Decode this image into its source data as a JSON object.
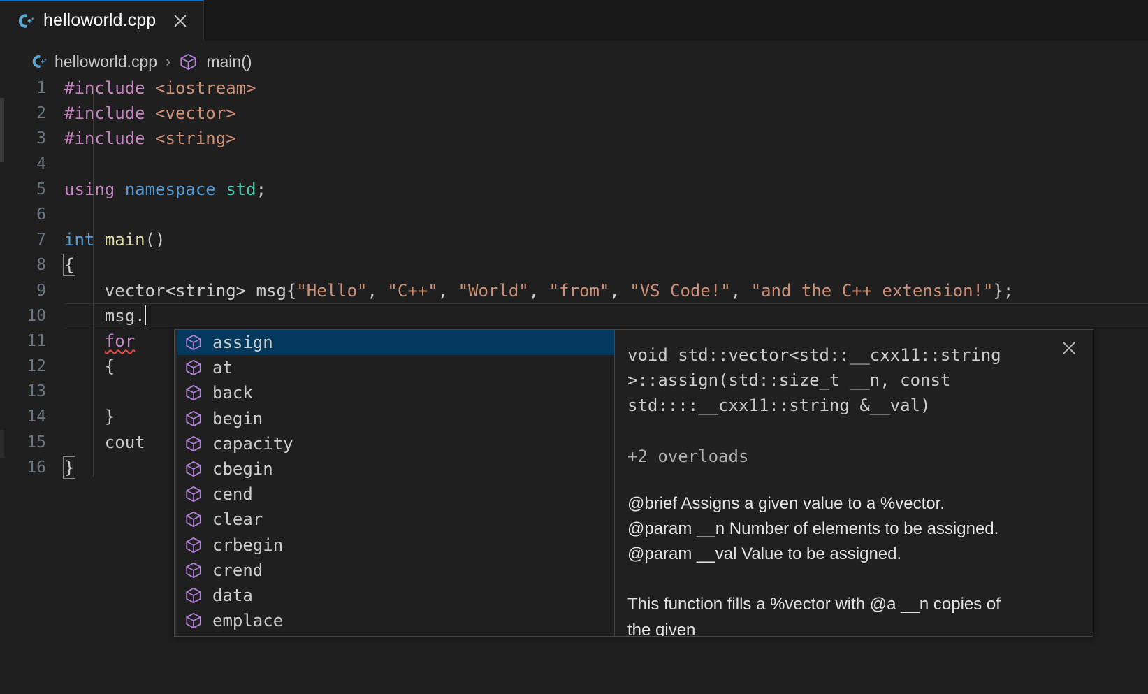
{
  "window": {
    "background": "#1f1f1f",
    "accent": "#0078d4",
    "selection": "#04395e"
  },
  "tab": {
    "label": "helloworld.cpp",
    "icon": "cpp-file-icon",
    "close": "close-icon"
  },
  "breadcrumb": {
    "file": "helloworld.cpp",
    "separator": "›",
    "symbol": "main()",
    "file_icon": "cpp-file-icon",
    "symbol_icon": "cube-symbol-icon"
  },
  "editor": {
    "lines": [
      {
        "number": "1",
        "tokens": [
          {
            "text": "#include",
            "cls": "t-pre"
          },
          {
            "text": " ",
            "cls": "t-plain"
          },
          {
            "text": "<iostream>",
            "cls": "t-inc"
          }
        ]
      },
      {
        "number": "2",
        "tokens": [
          {
            "text": "#include",
            "cls": "t-pre"
          },
          {
            "text": " ",
            "cls": "t-plain"
          },
          {
            "text": "<vector>",
            "cls": "t-inc"
          }
        ]
      },
      {
        "number": "3",
        "tokens": [
          {
            "text": "#include",
            "cls": "t-pre"
          },
          {
            "text": " ",
            "cls": "t-plain"
          },
          {
            "text": "<string>",
            "cls": "t-inc"
          }
        ]
      },
      {
        "number": "4",
        "tokens": []
      },
      {
        "number": "5",
        "tokens": [
          {
            "text": "using",
            "cls": "t-kw"
          },
          {
            "text": " ",
            "cls": "t-plain"
          },
          {
            "text": "namespace",
            "cls": "t-blue"
          },
          {
            "text": " ",
            "cls": "t-plain"
          },
          {
            "text": "std",
            "cls": "t-ns"
          },
          {
            "text": ";",
            "cls": "t-plain"
          }
        ]
      },
      {
        "number": "6",
        "tokens": []
      },
      {
        "number": "7",
        "tokens": [
          {
            "text": "int",
            "cls": "t-blue"
          },
          {
            "text": " ",
            "cls": "t-plain"
          },
          {
            "text": "main",
            "cls": "t-fn"
          },
          {
            "text": "()",
            "cls": "t-plain"
          }
        ]
      },
      {
        "number": "8",
        "tokens": [
          {
            "text": "{",
            "cls": "t-plain brk"
          }
        ]
      },
      {
        "number": "9",
        "tokens": [
          {
            "text": "    ",
            "cls": "t-plain"
          },
          {
            "text": "vector",
            "cls": "t-plain"
          },
          {
            "text": "<",
            "cls": "t-plain"
          },
          {
            "text": "string",
            "cls": "t-plain"
          },
          {
            "text": "> msg{",
            "cls": "t-plain"
          },
          {
            "text": "\"Hello\"",
            "cls": "t-str"
          },
          {
            "text": ", ",
            "cls": "t-plain"
          },
          {
            "text": "\"C++\"",
            "cls": "t-str"
          },
          {
            "text": ", ",
            "cls": "t-plain"
          },
          {
            "text": "\"World\"",
            "cls": "t-str"
          },
          {
            "text": ", ",
            "cls": "t-plain"
          },
          {
            "text": "\"from\"",
            "cls": "t-str"
          },
          {
            "text": ", ",
            "cls": "t-plain"
          },
          {
            "text": "\"VS Code!\"",
            "cls": "t-str"
          },
          {
            "text": ", ",
            "cls": "t-plain"
          },
          {
            "text": "\"and the C++ extension!\"",
            "cls": "t-str"
          },
          {
            "text": "};",
            "cls": "t-plain"
          }
        ]
      },
      {
        "number": "10",
        "tokens": [
          {
            "text": "    ",
            "cls": "t-plain"
          },
          {
            "text": "msg.",
            "cls": "t-plain"
          }
        ],
        "caret": true,
        "current": true
      },
      {
        "number": "11",
        "tokens": [
          {
            "text": "    ",
            "cls": "t-plain"
          },
          {
            "text": "for",
            "cls": "t-kw squig"
          }
        ]
      },
      {
        "number": "12",
        "tokens": [
          {
            "text": "    ",
            "cls": "t-plain"
          },
          {
            "text": "{",
            "cls": "t-plain"
          }
        ]
      },
      {
        "number": "13",
        "tokens": []
      },
      {
        "number": "14",
        "tokens": [
          {
            "text": "    ",
            "cls": "t-plain"
          },
          {
            "text": "}",
            "cls": "t-plain"
          }
        ]
      },
      {
        "number": "15",
        "tokens": [
          {
            "text": "    ",
            "cls": "t-plain"
          },
          {
            "text": "cout",
            "cls": "t-plain"
          }
        ]
      },
      {
        "number": "16",
        "tokens": [
          {
            "text": "}",
            "cls": "t-plain brk"
          }
        ]
      }
    ]
  },
  "suggest": {
    "items": [
      {
        "label": "assign",
        "icon": "cube-method-icon",
        "selected": true
      },
      {
        "label": "at",
        "icon": "cube-method-icon",
        "selected": false
      },
      {
        "label": "back",
        "icon": "cube-method-icon",
        "selected": false
      },
      {
        "label": "begin",
        "icon": "cube-method-icon",
        "selected": false
      },
      {
        "label": "capacity",
        "icon": "cube-method-icon",
        "selected": false
      },
      {
        "label": "cbegin",
        "icon": "cube-method-icon",
        "selected": false
      },
      {
        "label": "cend",
        "icon": "cube-method-icon",
        "selected": false
      },
      {
        "label": "clear",
        "icon": "cube-method-icon",
        "selected": false
      },
      {
        "label": "crbegin",
        "icon": "cube-method-icon",
        "selected": false
      },
      {
        "label": "crend",
        "icon": "cube-method-icon",
        "selected": false
      },
      {
        "label": "data",
        "icon": "cube-method-icon",
        "selected": false
      },
      {
        "label": "emplace",
        "icon": "cube-method-icon",
        "selected": false
      }
    ],
    "doc": {
      "signature": "void std::vector<std::__cxx11::string >::assign(std::size_t __n, const std::::__cxx11::string &__val)",
      "overloads": "+2 overloads",
      "brief": "@brief Assigns a given value to a %vector.",
      "param_n": "@param __n Number of elements to be assigned.",
      "param_val": "@param __val Value to be assigned.",
      "description_line1": "This function fills a %vector with @a __n copies of",
      "description_line2": "the given",
      "close": "close-icon"
    }
  }
}
